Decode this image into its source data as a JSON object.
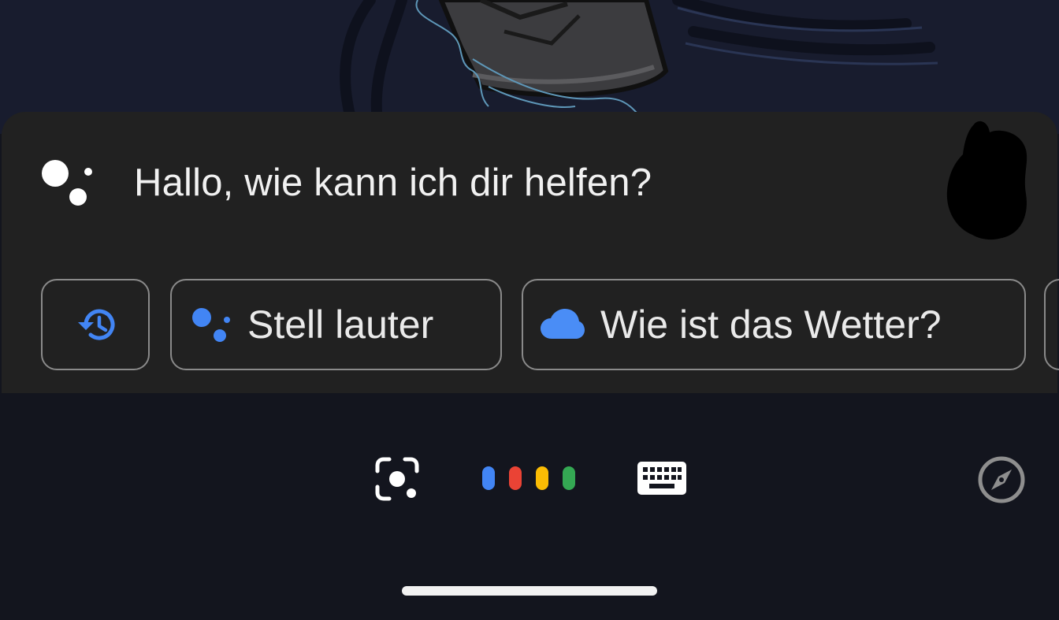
{
  "assistant": {
    "greeting": "Hallo, wie kann ich dir helfen?"
  },
  "suggestions": [
    {
      "icon": "history-icon",
      "label": ""
    },
    {
      "icon": "assistant-icon",
      "label": "Stell lauter"
    },
    {
      "icon": "cloud-icon",
      "label": "Wie ist das Wetter?"
    }
  ],
  "bottom_bar": {
    "icons": [
      "lens-icon",
      "voice-dots-icon",
      "keyboard-icon",
      "compass-icon"
    ]
  },
  "colors": {
    "sheet_background": "#212121",
    "screen_background": "#13151e",
    "google_blue": "#4285f4",
    "google_red": "#ea4335",
    "google_yellow": "#fbbc04",
    "google_green": "#34a853"
  }
}
